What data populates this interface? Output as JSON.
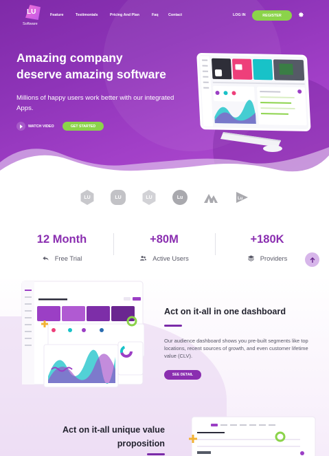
{
  "brand": {
    "logo_text": "LU",
    "name": "Software"
  },
  "nav": {
    "items": [
      "Feature",
      "Testimonials",
      "Pricing And Plan",
      "Faq",
      "Contact"
    ],
    "login": "LOG IN",
    "register": "REGISTER"
  },
  "hero": {
    "title_line1": "Amazing company",
    "title_line2": "deserve amazing software",
    "subtitle": "Millions of happy users work better with our integrated Apps.",
    "watch_video": "WATCH VIDEO",
    "get_started": "GET STARTED"
  },
  "partners": [
    {
      "icon": "lu-hex-logo-icon",
      "text": "LU"
    },
    {
      "icon": "lu-circle-logo-icon",
      "text": "LU"
    },
    {
      "icon": "lu-hex-logo-icon",
      "text": "LU"
    },
    {
      "icon": "lu-circle-logo-icon",
      "text": "Lu"
    },
    {
      "icon": "mountain-logo-icon",
      "text": ""
    },
    {
      "icon": "lu-play-logo-icon",
      "text": "Lu"
    }
  ],
  "stats": [
    {
      "value": "12 Month",
      "caption": "Free Trial",
      "icon": "reply-arrow-icon"
    },
    {
      "value": "+80M",
      "caption": "Active Users",
      "icon": "users-icon"
    },
    {
      "value": "+180K",
      "caption": "Providers",
      "icon": "layers-icon"
    }
  ],
  "feature1": {
    "title": "Act on it-all in one dashboard",
    "text": "Our audience dashboard shows you pre-built segments like top locations, recent sources of growth, and even customer lifetime value (CLV).",
    "button": "SEE DETAIL"
  },
  "feature2": {
    "title_line1": "Act on it-all unique value",
    "title_line2": "proposition"
  },
  "colors": {
    "primary": "#8a2eb0",
    "accent_green": "#8bd34a",
    "hero_start": "#7f2aa8",
    "hero_end": "#b24dd0"
  }
}
